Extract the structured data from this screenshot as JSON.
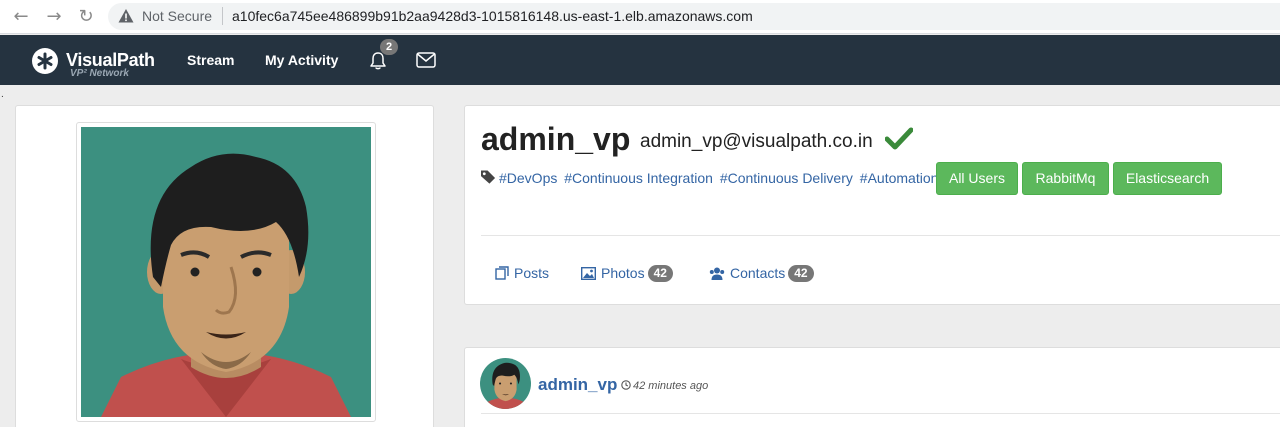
{
  "browser": {
    "security_label": "Not Secure",
    "url": "a10fec6a745ee486899b91b2aa9428d3-1015816148.us-east-1.elb.amazonaws.com",
    "back_icon": "arrow-left-icon",
    "forward_icon": "arrow-right-icon",
    "reload_icon": "reload-icon"
  },
  "navbar": {
    "brand": "VisualPath",
    "brand_tagline": "VP² Network",
    "links": [
      "Stream",
      "My Activity"
    ],
    "notification_count": "2",
    "bg_color": "#253340"
  },
  "profile": {
    "username": "admin_vp",
    "email": "admin_vp@visualpath.co.in",
    "verified": true,
    "hashtags": [
      "#DevOps",
      "#Continuous Integration",
      "#Continuous Delivery",
      "#Automation"
    ],
    "group_buttons": [
      "All Users",
      "RabbitMq",
      "Elasticsearch"
    ],
    "accent_color": "#5cb85c",
    "link_color": "#3465a4"
  },
  "tabs": [
    {
      "label": "Posts",
      "icon": "posts-icon"
    },
    {
      "label": "Photos",
      "icon": "image-icon",
      "count": "42"
    },
    {
      "label": "Contacts",
      "icon": "users-icon",
      "count": "42"
    }
  ],
  "post": {
    "author": "admin_vp",
    "time": "42 minutes ago"
  },
  "stray_text": "."
}
